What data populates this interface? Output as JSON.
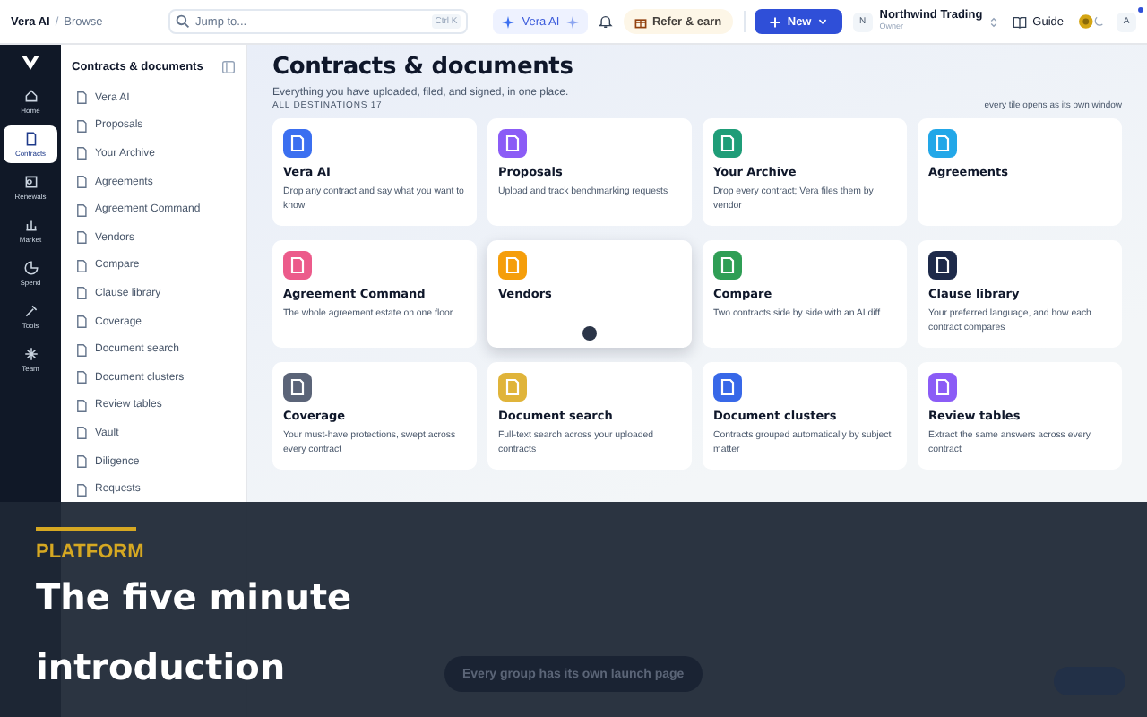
{
  "topbar": {
    "breadcrumb": [
      "Vera AI",
      "/",
      "Browse"
    ],
    "search": {
      "placeholder": "Jump to...",
      "shortcut": "Ctrl K"
    },
    "assistant": "Vera AI",
    "refer": "Refer & earn",
    "new_button": "New",
    "org": {
      "initial": "N",
      "name": "Northwind Trading",
      "role": "Owner"
    },
    "guide": "Guide",
    "avatar": "A"
  },
  "rail": [
    {
      "label": "Home",
      "selected": false
    },
    {
      "label": "Contracts",
      "selected": true
    },
    {
      "label": "Renewals",
      "selected": false
    },
    {
      "label": "Market",
      "selected": false
    },
    {
      "label": "Spend",
      "selected": false
    },
    {
      "label": "Tools",
      "selected": false
    },
    {
      "label": "Team",
      "selected": false
    }
  ],
  "sidebar": {
    "title": "Contracts & documents",
    "items": [
      "Vera AI",
      "Proposals",
      "Your Archive",
      "Agreements",
      "Agreement Command",
      "Vendors",
      "Compare",
      "Clause library",
      "Coverage",
      "Document search",
      "Document clusters",
      "Review tables",
      "Vault",
      "Diligence",
      "Requests"
    ]
  },
  "main": {
    "title": "Contracts & documents",
    "subtitle": "Everything you have uploaded, filed, and signed, in one place.",
    "count_label": "ALL DESTINATIONS 17",
    "hint": "every tile opens as its own window",
    "tiles": [
      {
        "title": "Vera AI",
        "desc": "Drop any contract and say what you want to know",
        "color": "#3b6ff0",
        "hovered": false
      },
      {
        "title": "Proposals",
        "desc": "Upload and track benchmarking requests",
        "color": "#8b5cf6",
        "hovered": false
      },
      {
        "title": "Your Archive",
        "desc": "Drop every contract; Vera files them by vendor",
        "color": "#1f9d78",
        "hovered": false
      },
      {
        "title": "Agreements",
        "color": "#22a7e8",
        "hovered": false
      },
      {
        "title": "Agreement Command",
        "desc": "The whole agreement estate on one floor",
        "color": "#ec5b8b",
        "hovered": false
      },
      {
        "title": "Vendors",
        "color": "#f59e0b",
        "hovered": true
      },
      {
        "title": "Compare",
        "desc": "Two contracts side by side with an AI diff",
        "color": "#2f9e55",
        "hovered": false
      },
      {
        "title": "Clause library",
        "desc": "Your preferred language, and how each contract compares",
        "color": "#1e2a4a",
        "hovered": false
      },
      {
        "title": "Coverage",
        "desc": "Your must-have protections, swept across every contract",
        "color": "#5b6478",
        "hovered": false
      },
      {
        "title": "Document search",
        "desc": "Full-text search across your uploaded contracts",
        "color": "#e0b43a",
        "hovered": false
      },
      {
        "title": "Document clusters",
        "desc": "Contracts grouped automatically by subject matter",
        "color": "#3868e8",
        "hovered": false
      },
      {
        "title": "Review tables",
        "desc": "Extract the same answers across every contract",
        "color": "#8b5cf6",
        "hovered": false
      }
    ],
    "launch_pill": "Every group has its own launch page"
  },
  "overlay": {
    "eyebrow": "PLATFORM",
    "title_lines": [
      "The five minute",
      "introduction"
    ]
  }
}
